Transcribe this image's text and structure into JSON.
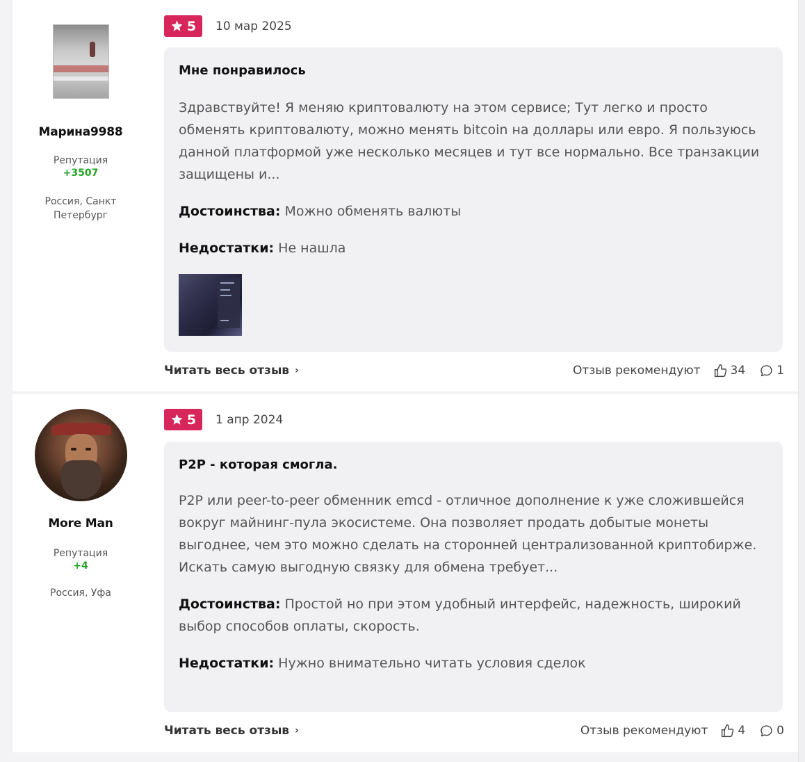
{
  "reviews": [
    {
      "author": "Марина9988",
      "reputation_label": "Репутация",
      "reputation": "+3507",
      "location": "Россия, Санкт Петербург",
      "rating": "5",
      "date": "10 мар 2025",
      "title": "Мне понравилось",
      "text": "Здравствуйте! Я меняю криптовалюту на этом сервисе; Тут легко и просто обменять криптовалюту, можно менять bitcoin на доллары или евро. Я пользуюсь данной платформой уже несколько месяцев и тут все нормально. Все транзакции защищены и...",
      "pros_label": "Достоинства:",
      "pros": "Можно обменять валюты",
      "cons_label": "Недостатки:",
      "cons": "Не нашла",
      "read_more": "Читать весь отзыв",
      "recommend_label": "Отзыв рекомендуют",
      "likes": "34",
      "comments": "1"
    },
    {
      "author": "More Man",
      "reputation_label": "Репутация",
      "reputation": "+4",
      "location": "Россия, Уфа",
      "rating": "5",
      "date": "1 апр 2024",
      "title": "P2P - которая смогла.",
      "text": "P2P или peer-to-peer обменник emcd - отличное дополнение к уже сложившейся вокруг майнинг-пула экосистеме. Она позволяет продать добытые монеты выгоднее, чем это можно сделать на сторонней централизованной криптобирже. Искать самую выгодную связку для обмена требует...",
      "pros_label": "Достоинства:",
      "pros": "Простой но при этом удобный интерфейс, надежность, широкий выбор способов оплаты, скорость.",
      "cons_label": "Недостатки:",
      "cons": "Нужно внимательно читать условия сделок",
      "read_more": "Читать весь отзыв",
      "recommend_label": "Отзыв рекомендуют",
      "likes": "4",
      "comments": "0"
    }
  ],
  "colors": {
    "badge": "#d7265b",
    "reputation": "#22a326",
    "card_bg": "#f1f1f3"
  },
  "icons": {
    "rating": "star-icon",
    "like": "thumbs-up-icon",
    "comment": "comment-bubble-icon",
    "read_more": "chevron-right-icon"
  }
}
